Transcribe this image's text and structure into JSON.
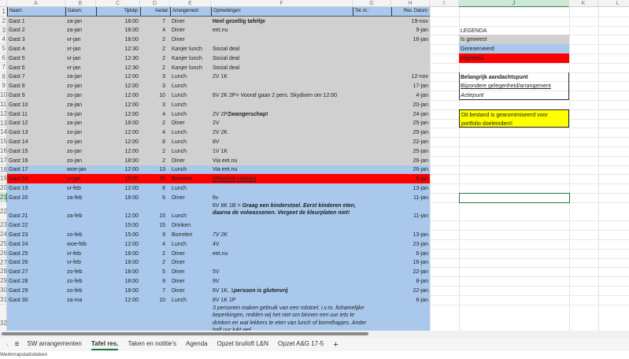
{
  "colors": {
    "geweest": "#d0d0d0",
    "gereserveerd": "#a9c8ec",
    "afgemeld": "#ff0000",
    "header": "#a9c8ec",
    "note": "#ffff00",
    "accent": "#1d7a3f"
  },
  "columns": [
    "A",
    "B",
    "C",
    "D",
    "E",
    "F",
    "G",
    "H",
    "I",
    "J",
    "K",
    "L"
  ],
  "header": {
    "a": "Naam:",
    "b": "Datum:",
    "c": "Tijdstip:",
    "d": "Aantal:",
    "e": "Arrangement:",
    "f": "Opmerkingen:",
    "g": "Tel. nr.:",
    "h": "Res. Datum:"
  },
  "rows": [
    {
      "n": "2",
      "st": "geweest",
      "a": "Gast 1",
      "b": "za-jan",
      "c": "18:00",
      "d": "7",
      "e": "Diner",
      "f": [
        {
          "t": "Heel gezellig tafeltje",
          "s": "b"
        }
      ],
      "h": "19-nov"
    },
    {
      "n": "3",
      "st": "geweest",
      "a": "Gast 2",
      "b": "za-jan",
      "c": "18:00",
      "d": "4",
      "e": "Diner",
      "f": [
        {
          "t": "eet.nu"
        }
      ],
      "h": "9-jan"
    },
    {
      "n": "4",
      "st": "geweest",
      "a": "Gast 3",
      "b": "vr-jan",
      "c": "18:00",
      "d": "2",
      "e": "Diner",
      "f": [],
      "h": "16-jan"
    },
    {
      "n": "5",
      "st": "geweest",
      "a": "Gast 4",
      "b": "vr-jan",
      "c": "12:30",
      "d": "2",
      "e": "Kanjer lunch",
      "f": [
        {
          "t": "Social deal"
        }
      ],
      "h": ""
    },
    {
      "n": "6",
      "st": "geweest",
      "a": "Gast 5",
      "b": "vr-jan",
      "c": "12:30",
      "d": "2",
      "e": "Kanjer lunch",
      "f": [
        {
          "t": "Social deal"
        }
      ],
      "h": ""
    },
    {
      "n": "7",
      "st": "geweest",
      "a": "Gast 6",
      "b": "vr-jan",
      "c": "12:30",
      "d": "2",
      "e": "Kanjer lunch",
      "f": [
        {
          "t": "Social deal"
        }
      ],
      "h": ""
    },
    {
      "n": "8",
      "st": "geweest",
      "a": "Gast 7",
      "b": "za-jan",
      "c": "12:00",
      "d": "3",
      "e": "Lunch",
      "f": [
        {
          "t": "2V 1K"
        }
      ],
      "h": "12-nov"
    },
    {
      "n": "9",
      "st": "geweest",
      "a": "Gast 8",
      "b": "zo-jan",
      "c": "12:00",
      "d": "3",
      "e": "Lunch",
      "f": [],
      "h": "17-jan"
    },
    {
      "n": "10",
      "st": "geweest",
      "a": "Gast 9",
      "b": "zo-jan",
      "c": "12:00",
      "d": "10",
      "e": "Lunch",
      "f": [
        {
          "t": "6V 2K 2P> Vooraf gaan 2 pers. Skydiven om 12:00"
        }
      ],
      "h": "4-jan"
    },
    {
      "n": "11",
      "st": "geweest",
      "a": "Gast 10",
      "b": "za-jan",
      "c": "12:00",
      "d": "3",
      "e": "Lunch",
      "f": [],
      "h": "20-jan"
    },
    {
      "n": "12",
      "st": "geweest",
      "a": "Gast 11",
      "b": "za-jan",
      "c": "12:00",
      "d": "4",
      "e": "Lunch",
      "f": [
        {
          "t": "2V 2P "
        },
        {
          "t": "Zwangerschap!",
          "s": "b"
        }
      ],
      "h": "24-jan"
    },
    {
      "n": "13",
      "st": "geweest",
      "a": "Gast 12",
      "b": "za-jan",
      "c": "18:00",
      "d": "2",
      "e": "Diner",
      "f": [
        {
          "t": "2V"
        }
      ],
      "h": "25-jan"
    },
    {
      "n": "14",
      "st": "geweest",
      "a": "Gast 13",
      "b": "zo-jan",
      "c": "12:00",
      "d": "4",
      "e": "Lunch",
      "f": [
        {
          "t": "2V 2K"
        }
      ],
      "h": "25-jan"
    },
    {
      "n": "15",
      "st": "geweest",
      "a": "Gast 14",
      "b": "zo-jan",
      "c": "12:00",
      "d": "8",
      "e": "Lunch",
      "f": [
        {
          "t": "8V"
        }
      ],
      "h": "22-jan"
    },
    {
      "n": "16",
      "st": "geweest",
      "a": "Gast 15",
      "b": "zo-jan",
      "c": "12:00",
      "d": "2",
      "e": "Lunch",
      "f": [
        {
          "t": "1V 1K"
        }
      ],
      "h": "25-jan"
    },
    {
      "n": "17",
      "st": "geweest",
      "a": "Gast 16",
      "b": "zo-jan",
      "c": "18:00",
      "d": "2",
      "e": "Diner",
      "f": [
        {
          "t": "Via eet.nu"
        }
      ],
      "h": "26-jan"
    },
    {
      "n": "18",
      "st": "gereserveerd",
      "a": "Gast 17",
      "b": "woe-jan",
      "c": "12:00",
      "d": "13",
      "e": "Lunch",
      "f": [
        {
          "t": "Via eet.nu"
        }
      ],
      "h": "26-jan"
    },
    {
      "n": "19",
      "st": "afgemeld",
      "a": "Gast 18",
      "b": "vr-jan",
      "c": "15:00",
      "d": "20",
      "e": "Borrelen",
      "f": [
        {
          "t": "(Afscheid collega)",
          "s": "u"
        }
      ],
      "h": "8-jan"
    },
    {
      "n": "20",
      "st": "gereserveerd",
      "a": "Gast 19",
      "b": "vr-feb",
      "c": "12:00",
      "d": "8",
      "e": "Lunch",
      "f": [],
      "h": "13-jan"
    },
    {
      "n": "21",
      "st": "gereserveerd",
      "a": "Gast 20",
      "b": "za-feb",
      "c": "18:00",
      "d": "6",
      "e": "Diner",
      "f": [
        {
          "t": "6v"
        }
      ],
      "h": "11-jan"
    },
    {
      "n": "22",
      "st": "gereserveerd",
      "tall": 2,
      "a": "Gast 21",
      "b": "za-feb",
      "c": "12:00",
      "d": "15",
      "e": "Lunch",
      "f": [
        {
          "t": "6V 8K 1B > "
        },
        {
          "t": "Graag een kinderstoel. Eerst kinderen eten, daarna de volwassenen. Vergeet de kleurplaten niet!",
          "s": "bi"
        }
      ],
      "h": "11-jan"
    },
    {
      "n": "23",
      "st": "gereserveerd",
      "a": "Gast 22",
      "b": "",
      "c": "15:00",
      "d": "15",
      "e": "Drinken",
      "f": [],
      "h": ""
    },
    {
      "n": "24",
      "st": "gereserveerd",
      "a": "Gast 23",
      "b": "zo-feb",
      "c": "15:00",
      "d": "9",
      "e": "Borrelen",
      "f": [
        {
          "t": "7V 2K",
          "s": "i"
        }
      ],
      "h": "13-jan"
    },
    {
      "n": "25",
      "st": "gereserveerd",
      "a": "Gast 24",
      "b": "woe-feb",
      "c": "12:00",
      "d": "4",
      "e": "Lunch",
      "f": [
        {
          "t": "4V"
        }
      ],
      "h": "23-jan"
    },
    {
      "n": "26",
      "st": "gereserveerd",
      "a": "Gast 25",
      "b": "vr-feb",
      "c": "18:00",
      "d": "2",
      "e": "Diner",
      "f": [
        {
          "t": "eet.nu"
        }
      ],
      "h": "6-jan"
    },
    {
      "n": "27",
      "st": "gereserveerd",
      "a": "Gast 26",
      "b": "vr-feb",
      "c": "18:00",
      "d": "2",
      "e": "Diner",
      "f": [],
      "h": "16-jan"
    },
    {
      "n": "28",
      "st": "gereserveerd",
      "a": "Gast 27",
      "b": "zo-feb",
      "c": "18:00",
      "d": "5",
      "e": "Diner",
      "f": [
        {
          "t": "5V"
        }
      ],
      "h": "22-jan"
    },
    {
      "n": "29",
      "st": "gereserveerd",
      "a": "Gast 28",
      "b": "zo-feb",
      "c": "18:00",
      "d": "9",
      "e": "Diner",
      "f": [
        {
          "t": "9V"
        }
      ],
      "h": "8-jan"
    },
    {
      "n": "30",
      "st": "gereserveerd",
      "a": "Gast 29",
      "b": "zo-feb",
      "c": "18:00",
      "d": "7",
      "e": "Diner",
      "f": [
        {
          "t": "6V 1K. 1 "
        },
        {
          "t": "persoon is glutenvrij",
          "s": "bi"
        }
      ],
      "h": "22-jan"
    },
    {
      "n": "31",
      "st": "gereserveerd",
      "a": "Gast 30",
      "b": "za-ma",
      "c": "12:00",
      "d": "10",
      "e": "Lunch",
      "f": [
        {
          "t": "8V 1K 1P"
        }
      ],
      "h": "6-jan"
    },
    {
      "n": "32",
      "st": "gereserveerd",
      "tall": 4,
      "a": "Gast 31",
      "b": "za-ma",
      "c": "13:00",
      "d": "12",
      "e": "Lunch/borrel",
      "f": [
        {
          "t": "3 personen maken gebruik van een rolstoel. i.v.m. lichamelijke beperkingen, redden wij het niet om binnen een uur iets te drinken en wat lekkers te eten van lunch of borrelhapjes. Ander half uur lukt wel.",
          "s": "i"
        }
      ],
      "h": "18-jan"
    },
    {
      "n": "33",
      "st": "gereserveerd",
      "a": "",
      "b": "",
      "c": "",
      "d": "",
      "e": "",
      "f": [],
      "h": ""
    }
  ],
  "legend": {
    "title": "LEGENDA",
    "geweest": "Is geweest",
    "gereserveerd": "Gereserveerd",
    "afgemeld": "Afgemeld",
    "aandachtspunt": "Belangrijk aandachtspunt",
    "gelegenheid": "Bijzondere gelegenheid/arrangement",
    "actiepunt": "Actiepunt",
    "note": "Dit bestand is geanonimiseerd voor portfolio doeleinden!!"
  },
  "tabs": [
    "SW arrangementen",
    "Tafel res.",
    "Taken en notitie's",
    "Agenda",
    "Opzet bruiloft L&N",
    "Opzet A&G 17-5"
  ],
  "active_tab": "Tafel res.",
  "status": "Werkmapstatistieken"
}
